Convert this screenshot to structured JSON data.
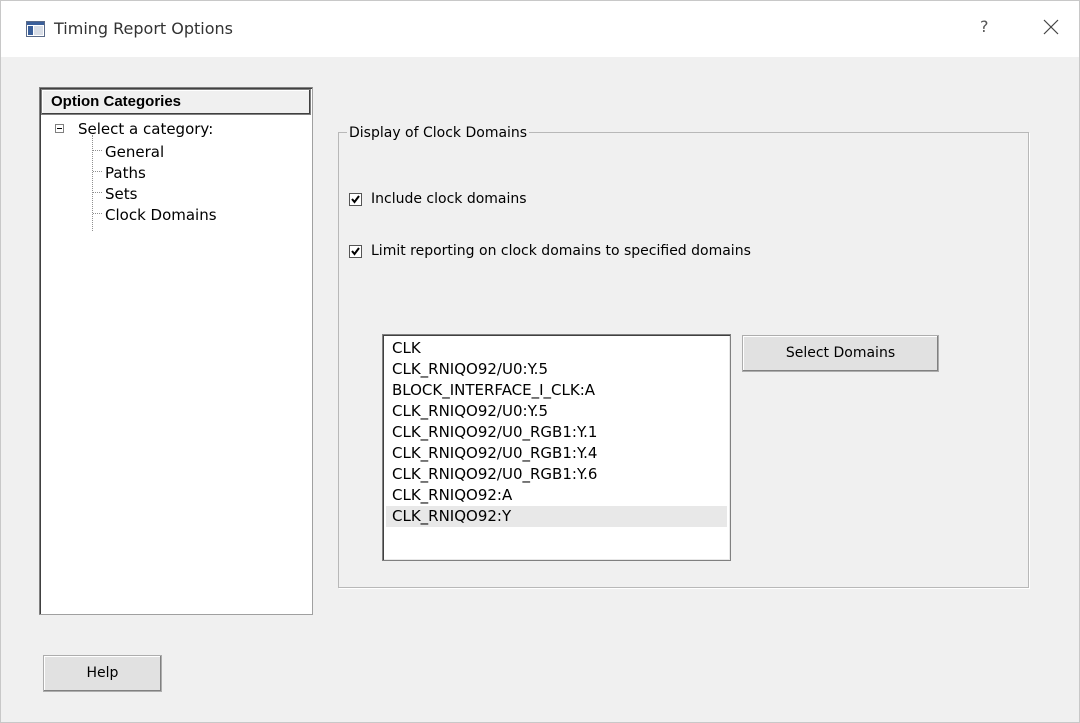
{
  "window": {
    "title": "Timing Report Options",
    "help_glyph": "?",
    "close_icon": "close-icon"
  },
  "categories": {
    "header": "Option Categories",
    "root_label": "Select a category:",
    "items": [
      "General",
      "Paths",
      "Sets",
      "Clock Domains"
    ],
    "selected": "Clock Domains"
  },
  "clock_domains": {
    "group_label": "Display of Clock Domains",
    "include_label": "Include clock domains",
    "include_checked": true,
    "limit_label": "Limit reporting on clock domains to specified  domains",
    "limit_checked": true,
    "domains": [
      "CLK",
      "CLK_RNIQO92/U0:Y.5",
      "BLOCK_INTERFACE_I_CLK:A",
      "CLK_RNIQO92/U0:Y.5",
      "CLK_RNIQO92/U0_RGB1:Y.1",
      "CLK_RNIQO92/U0_RGB1:Y.4",
      "CLK_RNIQO92/U0_RGB1:Y.6",
      "CLK_RNIQO92:A",
      "CLK_RNIQO92:Y"
    ],
    "selected_domain_index": 8,
    "select_button": "Select Domains"
  },
  "footer": {
    "help_button": "Help"
  }
}
